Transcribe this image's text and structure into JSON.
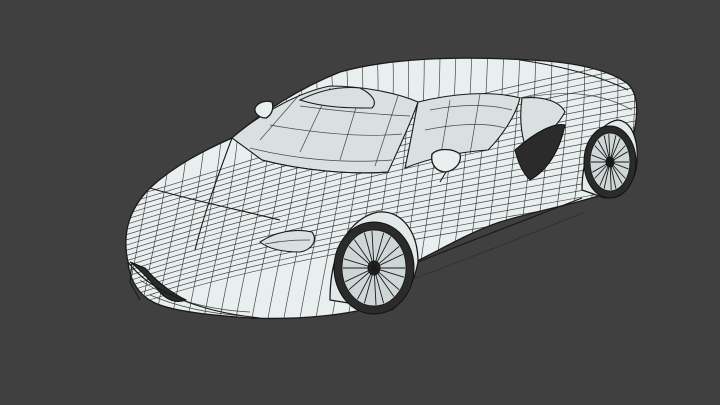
{
  "scene": {
    "background_color": "#404040",
    "model_surface_color": "#e9eeee",
    "wire_color": "#1a1a1a",
    "subject": "car-wireframe-model"
  }
}
